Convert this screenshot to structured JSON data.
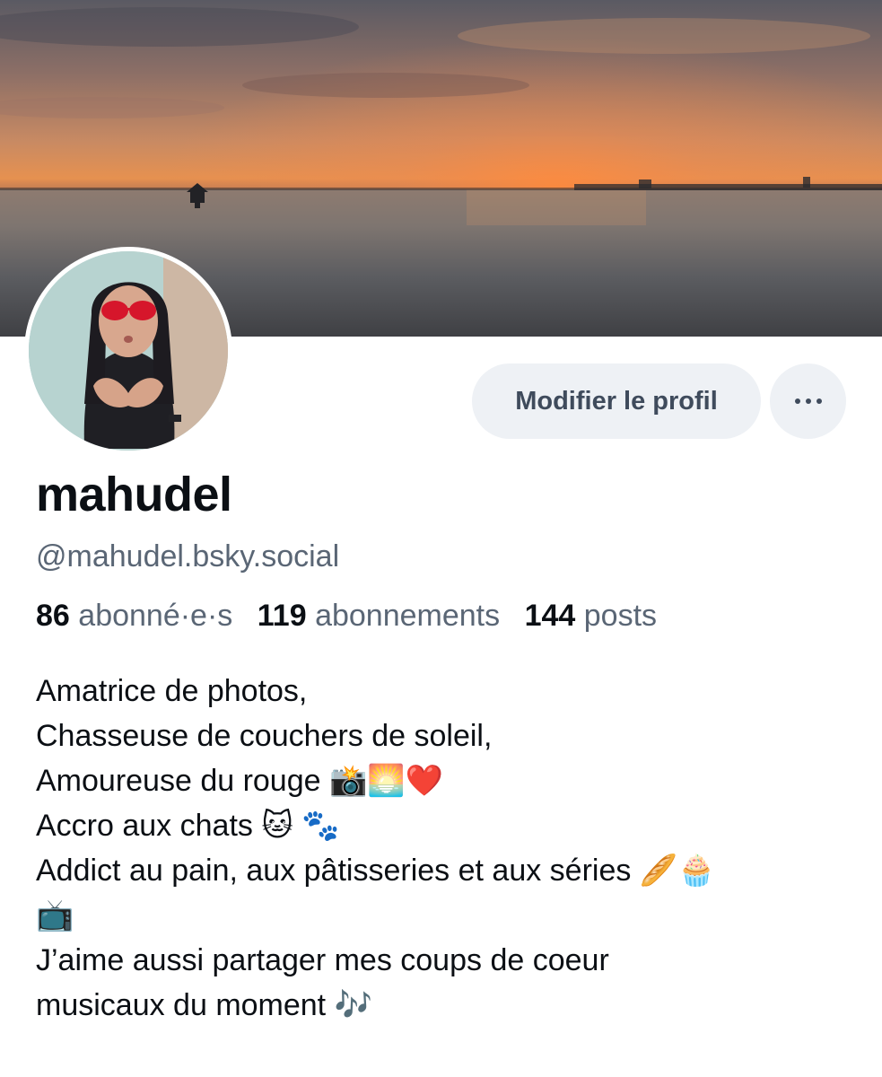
{
  "profile": {
    "display_name": "mahudel",
    "handle": "@mahudel.bsky.social",
    "edit_label": "Modifier le profil",
    "more_icon": "ellipsis-icon"
  },
  "stats": [
    {
      "count": "86",
      "label": "abonné·e·s"
    },
    {
      "count": "119",
      "label": "abonnements"
    },
    {
      "count": "144",
      "label": "posts"
    }
  ],
  "bio_lines": [
    "Amatrice de photos,",
    "Chasseuse de couchers de soleil,",
    "Amoureuse du rouge 📸🌅❤️",
    "Accro aux chats 🐱 🐾",
    "Addict au pain, aux pâtisseries et aux séries  🥖🧁",
    "📺",
    "J’aime aussi partager mes coups de coeur",
    "musicaux du moment 🎶"
  ],
  "colors": {
    "button_bg": "#eef1f5",
    "button_text": "#3f4b5c",
    "muted_text": "#5a6675"
  }
}
